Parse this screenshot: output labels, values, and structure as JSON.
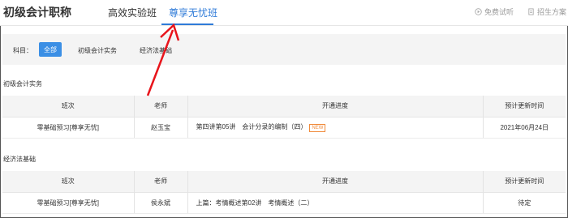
{
  "header": {
    "brand": "初级会计职称",
    "tabs": [
      {
        "label": "高效实验班"
      },
      {
        "label": "尊享无忧班"
      }
    ],
    "actions": [
      {
        "label": "免费试听",
        "icon": "play-icon"
      },
      {
        "label": "招生方案",
        "icon": "document-icon"
      }
    ]
  },
  "filter": {
    "label": "科目：",
    "options": [
      "全部",
      "初级会计实务",
      "经济法基础"
    ]
  },
  "sections": [
    {
      "title": "初级会计实务",
      "columns": [
        "班次",
        "老师",
        "开通进度",
        "预计更新时间"
      ],
      "rows": [
        {
          "class": "零基础预习[尊享无忧]",
          "teacher": "赵玉宝",
          "progress": "第四讲第05讲　会计分录的编制（四）",
          "badge": "NEW",
          "update": "2021年06月24日"
        }
      ]
    },
    {
      "title": "经济法基础",
      "columns": [
        "班次",
        "老师",
        "开通进度",
        "预计更新时间"
      ],
      "rows": [
        {
          "class": "零基础预习[尊享无忧]",
          "teacher": "侯永斌",
          "progress": "上篇：考情概述第02讲　考情概述（二）",
          "update": "待定"
        }
      ]
    }
  ],
  "colors": {
    "accent": "#2f7bd8",
    "pill": "#3b8fe5",
    "badge": "#f08a3a",
    "annotation": "#e8141b"
  }
}
